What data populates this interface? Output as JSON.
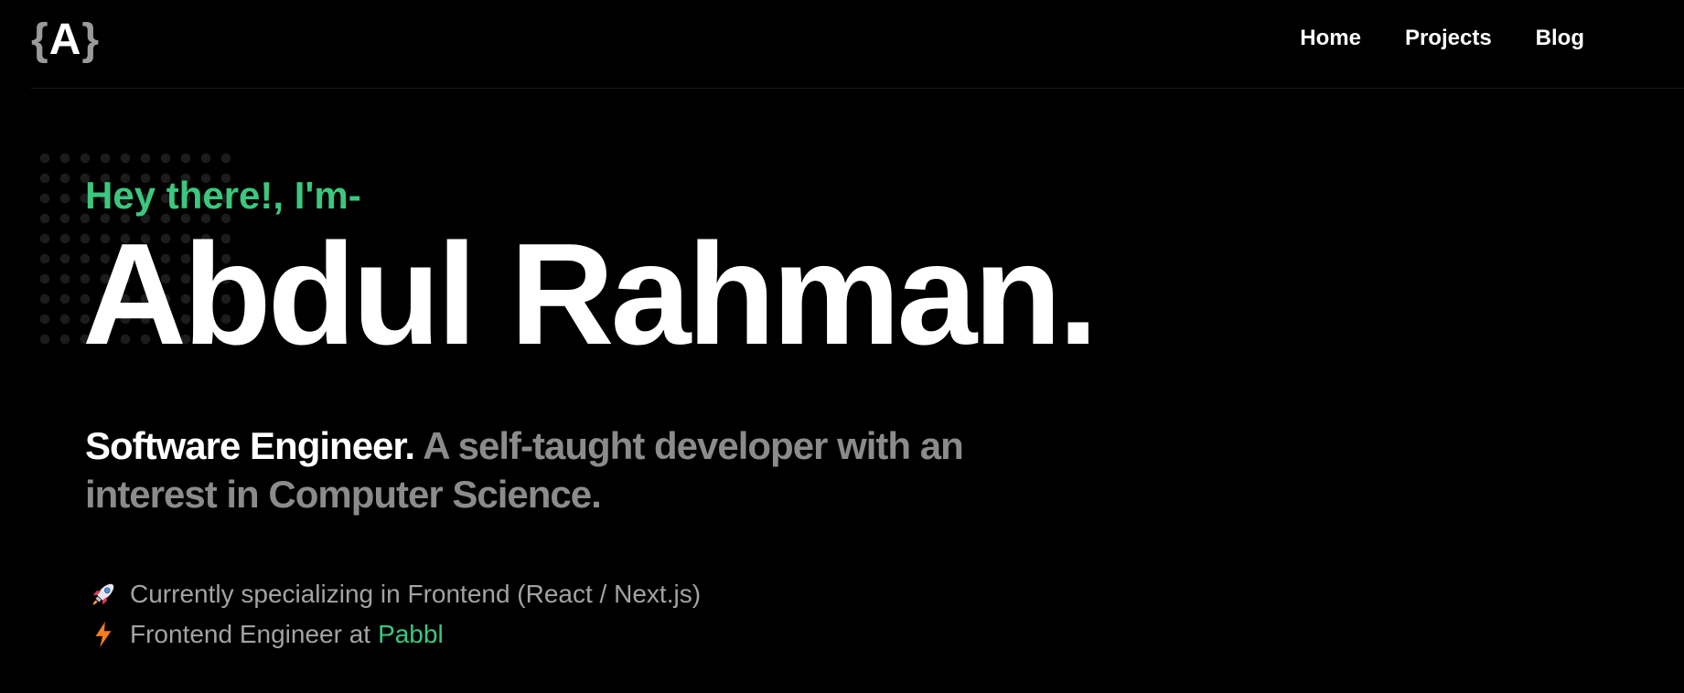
{
  "header": {
    "logo": {
      "open": "{",
      "letter": "A",
      "close": "}"
    },
    "nav": [
      {
        "label": "Home"
      },
      {
        "label": "Projects"
      },
      {
        "label": "Blog"
      }
    ]
  },
  "hero": {
    "greeting": "Hey there!, I'm-",
    "name": "Abdul Rahman.",
    "role": "Software Engineer.",
    "description": " A self-taught developer with an interest in Computer Science."
  },
  "facts": [
    {
      "icon": "rocket-icon",
      "text": "Currently specializing in Frontend (React / Next.js)"
    },
    {
      "icon": "lightning-icon",
      "text": "Frontend Engineer at",
      "company": "Pabbl"
    }
  ],
  "colors": {
    "background": "#000000",
    "accent": "#3cc77e",
    "muted": "#8b8b8b",
    "text": "#ffffff"
  }
}
